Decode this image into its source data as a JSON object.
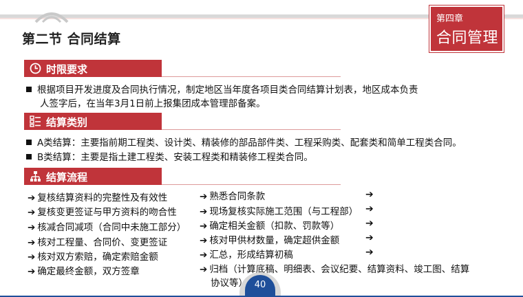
{
  "header": {
    "section_title": "第二节  合同结算",
    "chapter_label": "第四章",
    "chapter_title": "合同管理"
  },
  "colors": {
    "accent": "#c0343a",
    "page_badge": "#1f4f9a"
  },
  "section_time": {
    "icon": "clock-icon",
    "title": "时限要求",
    "line1": "根据项目开发进度及合同执行情况，制定地区当年度各项目类合同结算计划表，地区成本负责",
    "line2": "人签字后，在当年3月1日前上报集团成本管理部备案。"
  },
  "section_types": {
    "icon": "list-icon",
    "title": "结算类别",
    "items": [
      "A类结算：主要指前期工程类、设计类、精装修的部品部件类、工程采购类、配套类和简单工程类合同。",
      "B类结算：主要是指土建工程类、安装工程类和精装修工程类合同。"
    ]
  },
  "section_flow": {
    "icon": "hierarchy-icon",
    "title": "结算流程",
    "left": [
      "复核结算资料的完整性及有效性",
      "复核变更签证与甲方资料的吻合性",
      "核减合同减项（合同中未施工部分）",
      "核对工程量、合同价、变更签证",
      "核对双方索赔，确定索赔金额",
      "确定最终金额，双方签章"
    ],
    "right": [
      "熟悉合同条款",
      "现场复核实际施工范围（与工程部）",
      "确定相关金额（扣款、罚款等）",
      "核对甲供材数量，确定超供金额",
      "汇总，形成结算初稿",
      "归档（计算底稿、明细表、会议纪要、结算资料、竣工图、结算",
      "协议等）"
    ]
  },
  "footer": {
    "page_number": "40"
  }
}
